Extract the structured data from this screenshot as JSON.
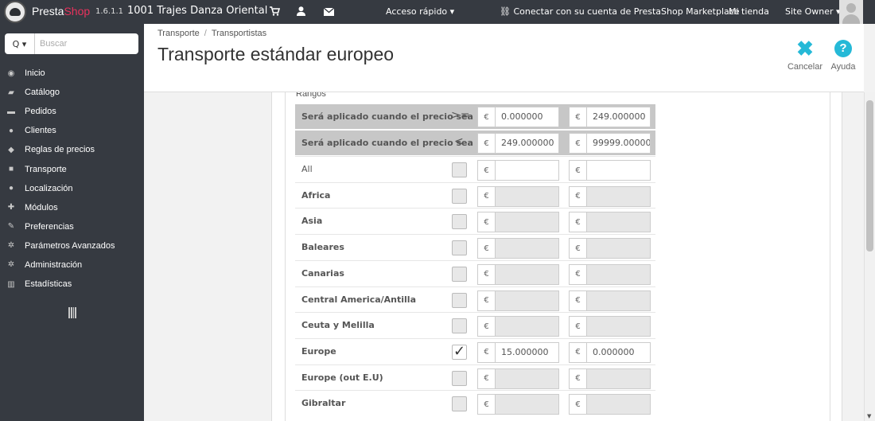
{
  "header": {
    "brand_presta": "Presta",
    "brand_shop": "Shop",
    "version": "1.6.1.1",
    "shop_name": "1001 Trajes Danza Oriental",
    "quick_access": "Acceso rápido ▾",
    "marketplace": "Conectar con su cuenta de PrestaShop Marketplace",
    "my_shop": "Mi tienda",
    "owner": "Site Owner ▾"
  },
  "sidebar": {
    "search_dropdown": "Q ▾",
    "search_placeholder": "Buscar",
    "items": [
      {
        "icon": "dashboard-icon",
        "glyph": "◉",
        "label": "Inicio"
      },
      {
        "icon": "book-icon",
        "glyph": "▰",
        "label": "Catálogo"
      },
      {
        "icon": "credit-card-icon",
        "glyph": "▬",
        "label": "Pedidos"
      },
      {
        "icon": "users-icon",
        "glyph": "●",
        "label": "Clientes"
      },
      {
        "icon": "tags-icon",
        "glyph": "◆",
        "label": "Reglas de precios"
      },
      {
        "icon": "truck-icon",
        "glyph": "■",
        "label": "Transporte"
      },
      {
        "icon": "globe-icon",
        "glyph": "●",
        "label": "Localización"
      },
      {
        "icon": "puzzle-icon",
        "glyph": "✚",
        "label": "Módulos"
      },
      {
        "icon": "wrench-icon",
        "glyph": "✎",
        "label": "Preferencias"
      },
      {
        "icon": "cogs-icon",
        "glyph": "✲",
        "label": "Parámetros Avanzados"
      },
      {
        "icon": "cog-icon",
        "glyph": "✲",
        "label": "Administración"
      },
      {
        "icon": "bar-chart-icon",
        "glyph": "▥",
        "label": "Estadísticas"
      }
    ]
  },
  "page": {
    "breadcrumb": [
      "Transporte",
      "Transportistas"
    ],
    "breadcrumb_sep": "/",
    "title": "Transporte estándar europeo",
    "cancel_label": "Cancelar",
    "help_label": "Ayuda"
  },
  "ranges": {
    "section_label": "Rangos",
    "rows": [
      {
        "label": "Será aplicado cuando el precio sea",
        "operator": ">=",
        "currency": "€",
        "from": "0.000000",
        "to": "249.000000"
      },
      {
        "label": "Será aplicado cuando el precio sea",
        "operator": "<",
        "currency": "€",
        "from": "249.000000",
        "to": "99999.000000"
      }
    ]
  },
  "zones": [
    {
      "name": "All",
      "checked": false,
      "fee1": "",
      "fee2": "",
      "bold": false
    },
    {
      "name": "Africa",
      "checked": false,
      "fee1": "",
      "fee2": "",
      "bold": true
    },
    {
      "name": "Asia",
      "checked": false,
      "fee1": "",
      "fee2": "",
      "bold": true
    },
    {
      "name": "Baleares",
      "checked": false,
      "fee1": "",
      "fee2": "",
      "bold": true
    },
    {
      "name": "Canarias",
      "checked": false,
      "fee1": "",
      "fee2": "",
      "bold": true
    },
    {
      "name": "Central America/Antilla",
      "checked": false,
      "fee1": "",
      "fee2": "",
      "bold": true
    },
    {
      "name": "Ceuta y Melilla",
      "checked": false,
      "fee1": "",
      "fee2": "",
      "bold": true
    },
    {
      "name": "Europe",
      "checked": true,
      "fee1": "15.000000",
      "fee2": "0.000000",
      "bold": true
    },
    {
      "name": "Europe (out E.U)",
      "checked": false,
      "fee1": "",
      "fee2": "",
      "bold": true
    },
    {
      "name": "Gibraltar",
      "checked": false,
      "fee1": "",
      "fee2": "",
      "bold": true
    }
  ],
  "colors": {
    "accent": "#25b9d7",
    "header_bg": "#363a41",
    "brand_shop": "#e8325d"
  }
}
